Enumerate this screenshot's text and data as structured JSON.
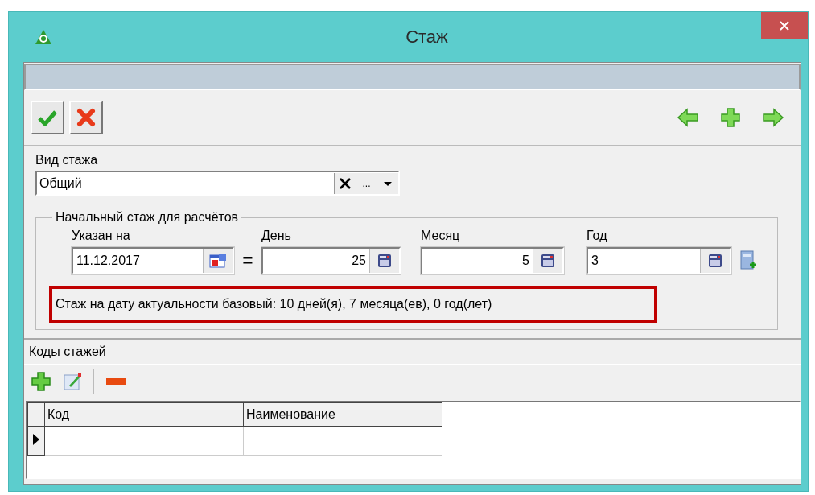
{
  "window": {
    "title": "Стаж"
  },
  "type_field": {
    "label": "Вид стажа",
    "value": "Общий",
    "browse": "..."
  },
  "initial_group": {
    "title": "Начальный стаж для расчётов",
    "fields": [
      {
        "label": "Указан на",
        "value": "11.12.2017",
        "kind": "date",
        "right_aligned": false
      },
      {
        "label": "День",
        "value": "25",
        "kind": "number",
        "right_aligned": true
      },
      {
        "label": "Месяц",
        "value": "5",
        "kind": "number",
        "right_aligned": true
      },
      {
        "label": "Год",
        "value": "3",
        "kind": "number",
        "right_aligned": false
      }
    ],
    "equals": "=",
    "summary": "Стаж на дату актуальности базовый:  10 дней(я), 7 месяца(ев), 0 год(лет)"
  },
  "codes": {
    "title": "Коды стажей",
    "columns": [
      "Код",
      "Наименование"
    ],
    "rows": [
      {
        "selected": true
      }
    ]
  }
}
